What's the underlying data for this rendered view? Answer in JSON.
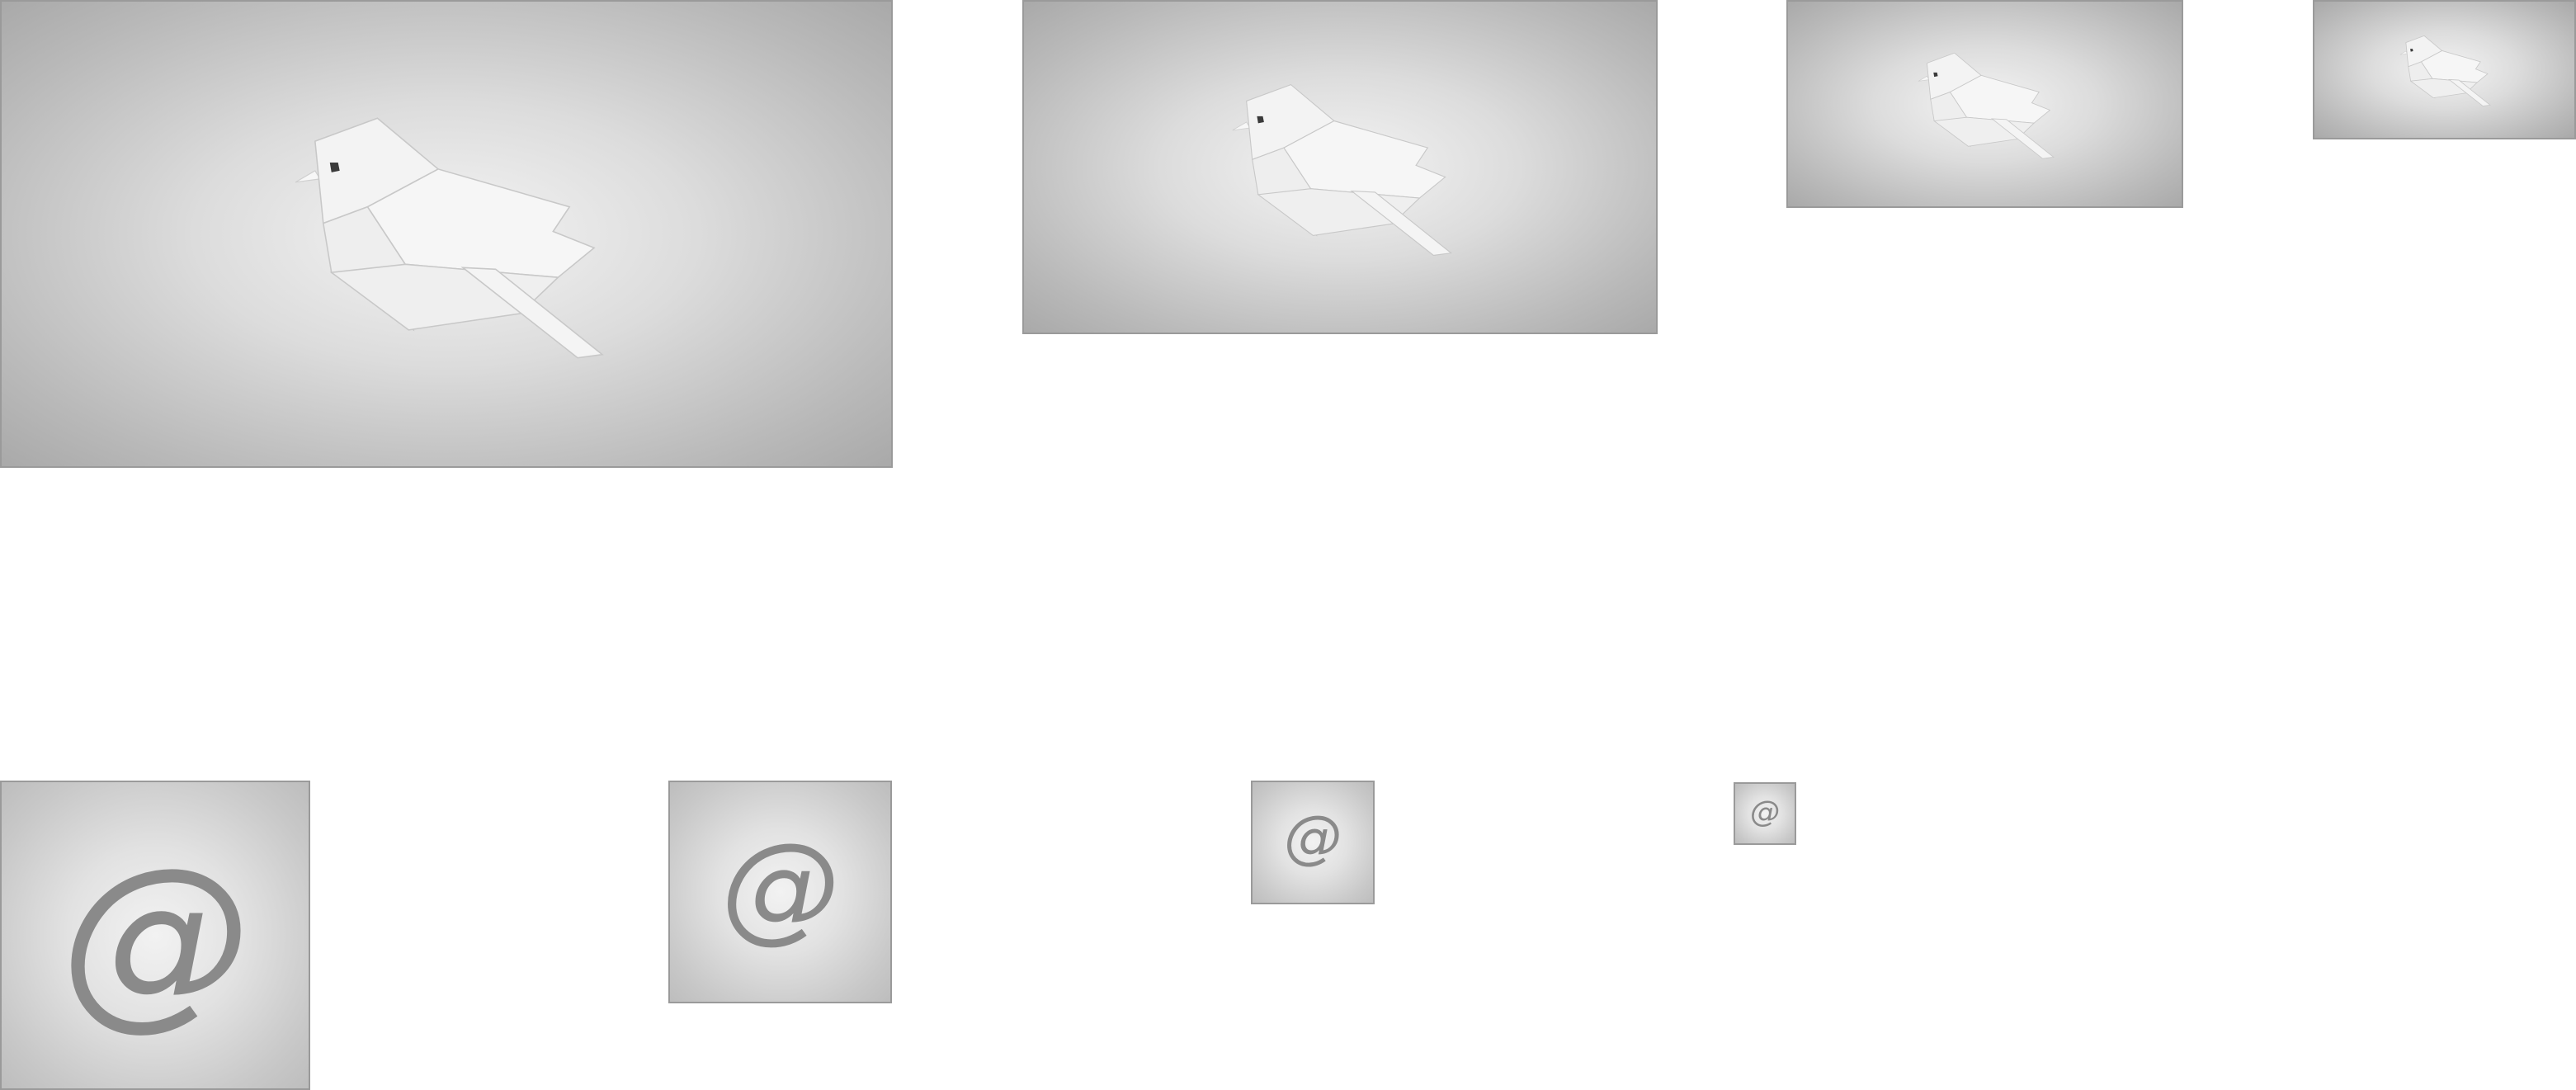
{
  "bird_tiles": [
    {
      "id": "bird-xl",
      "icon": "origami-bird"
    },
    {
      "id": "bird-l",
      "icon": "origami-bird"
    },
    {
      "id": "bird-m",
      "icon": "origami-bird"
    },
    {
      "id": "bird-s",
      "icon": "origami-bird"
    }
  ],
  "at_tiles": [
    {
      "id": "at-xl",
      "icon": "at-sign",
      "glyph": "@"
    },
    {
      "id": "at-l",
      "icon": "at-sign",
      "glyph": "@"
    },
    {
      "id": "at-m",
      "icon": "at-sign",
      "glyph": "@"
    },
    {
      "id": "at-s",
      "icon": "at-sign",
      "glyph": "@"
    }
  ],
  "colors": {
    "tile_border": "#9a9a9a",
    "bird_paper": "#f3f3f3",
    "bird_crease": "#c8c8c8",
    "bird_eye": "#3a3a3a",
    "at_glyph": "#8a8a8a"
  }
}
